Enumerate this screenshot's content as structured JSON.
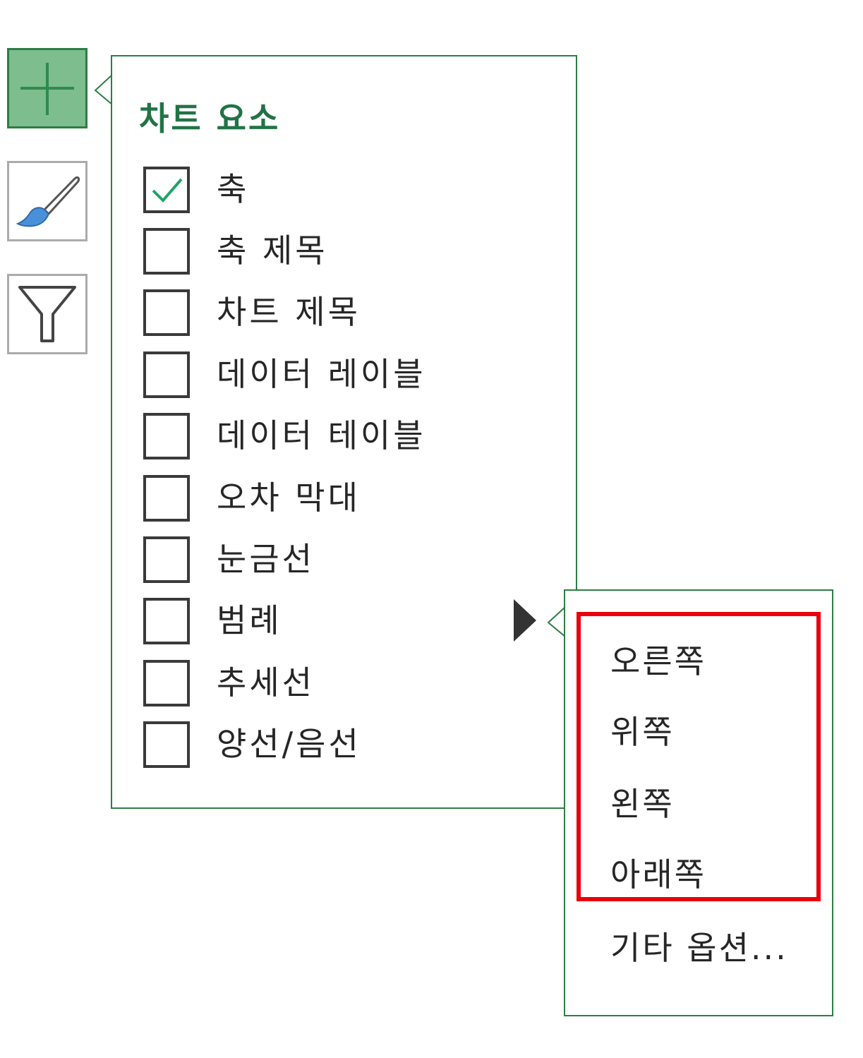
{
  "side_buttons": {
    "elements": {
      "icon": "plus-icon",
      "state": "active"
    },
    "styles": {
      "icon": "paintbrush-icon"
    },
    "filters": {
      "icon": "funnel-icon"
    }
  },
  "chart_elements_panel": {
    "title": "차트 요소",
    "items": [
      {
        "label": "축",
        "checked": true
      },
      {
        "label": "축 제목",
        "checked": false
      },
      {
        "label": "차트 제목",
        "checked": false
      },
      {
        "label": "데이터 레이블",
        "checked": false
      },
      {
        "label": "데이터 테이블",
        "checked": false
      },
      {
        "label": "오차 막대",
        "checked": false
      },
      {
        "label": "눈금선",
        "checked": false
      },
      {
        "label": "범례",
        "checked": false,
        "has_submenu": true
      },
      {
        "label": "추세선",
        "checked": false
      },
      {
        "label": "양선/음선",
        "checked": false
      }
    ]
  },
  "legend_submenu": {
    "items": [
      "오른쪽",
      "위쪽",
      "왼쪽",
      "아래쪽"
    ],
    "more_options": "기타 옵션..."
  },
  "colors": {
    "accent_green": "#217346",
    "active_button_fill": "#7dbd8e",
    "highlight_red": "#e8000b",
    "check_green": "#21a366"
  }
}
